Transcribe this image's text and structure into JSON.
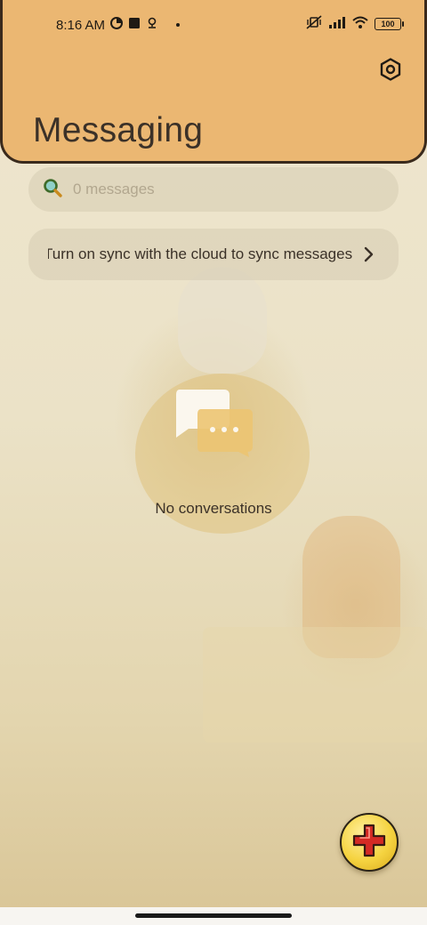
{
  "status_bar": {
    "time": "8:16 AM",
    "battery": "100",
    "icons": [
      "data-saver-icon",
      "app-square-icon",
      "location-pin-icon",
      "notification-dot-icon",
      "muted-vibrate-icon",
      "signal-icon",
      "wifi-icon",
      "battery-icon"
    ]
  },
  "header": {
    "title": "Messaging",
    "settings_icon": "settings-hexagon-icon",
    "color": "#ebb772"
  },
  "search": {
    "placeholder": "0 messages",
    "icon": "search-icon"
  },
  "sync_banner": {
    "text": "Turn on sync with the cloud to sync messages",
    "icon": "chevron-right-icon"
  },
  "empty_state": {
    "icon": "conversations-icon",
    "text": "No conversations"
  },
  "fab": {
    "icon": "plus-icon",
    "color": "#f5d340"
  }
}
